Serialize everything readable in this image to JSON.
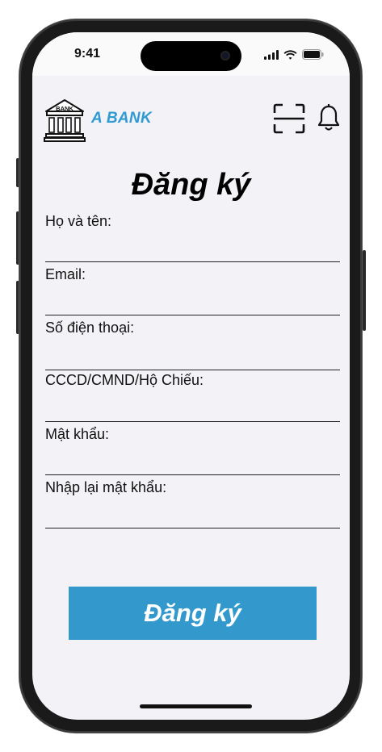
{
  "status_bar": {
    "time": "9:41"
  },
  "header": {
    "logo_text": "BANK",
    "brand": "A BANK",
    "scan_icon": "qr-scan-icon",
    "bell_icon": "bell-icon"
  },
  "form": {
    "title": "Đăng ký",
    "fields": [
      {
        "label": "Họ và tên:",
        "value": ""
      },
      {
        "label": "Email:",
        "value": ""
      },
      {
        "label": "Số điện thoại:",
        "value": ""
      },
      {
        "label": "CCCD/CMND/Hộ Chiếu:",
        "value": ""
      },
      {
        "label": "Mật khẩu:",
        "value": ""
      },
      {
        "label": "Nhập lại mật khẩu:",
        "value": ""
      }
    ],
    "submit_label": "Đăng ký"
  },
  "colors": {
    "accent": "#3399cc",
    "brand": "#2f9ad1",
    "background": "#f2f2f7"
  }
}
